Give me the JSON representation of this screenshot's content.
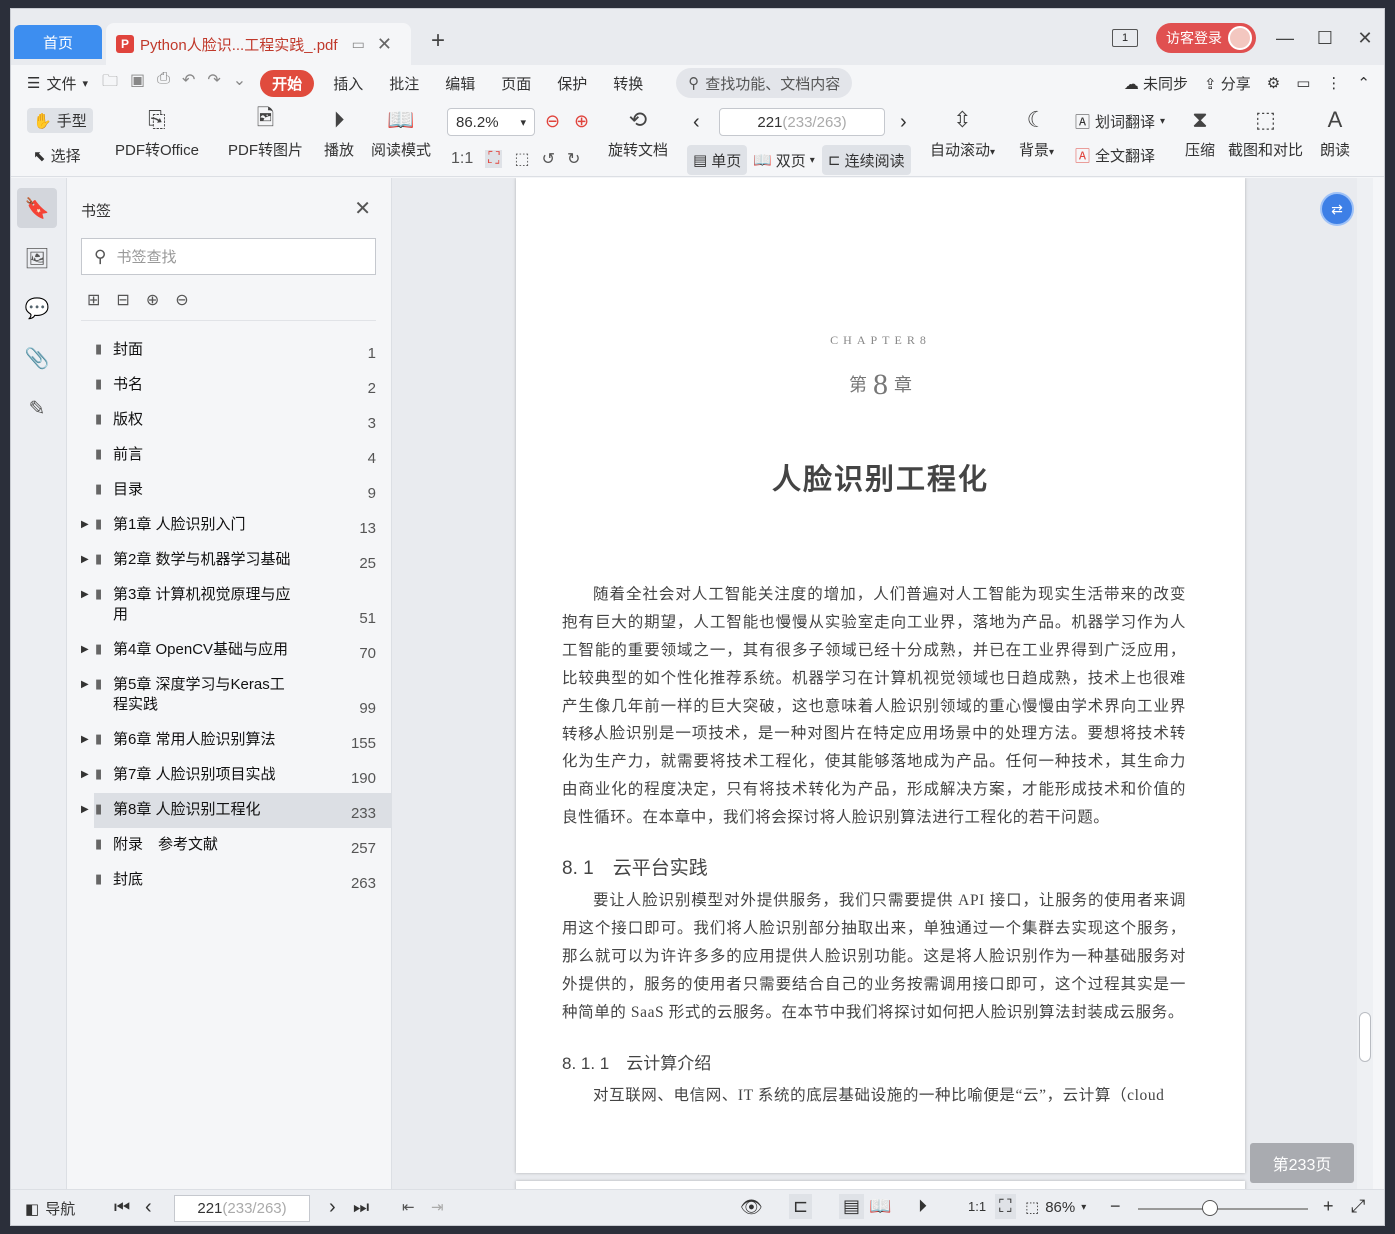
{
  "tabs": {
    "home": "首页",
    "doc": "Python人脸识...工程实践_.pdf"
  },
  "topright": {
    "badge": "1",
    "login": "访客登录"
  },
  "menu": {
    "file": "文件",
    "items": [
      "开始",
      "插入",
      "批注",
      "编辑",
      "页面",
      "保护",
      "转换"
    ],
    "search": "查找功能、文档内容",
    "sync": "未同步",
    "share": "分享"
  },
  "toolbar": {
    "hand": "手型",
    "select": "选择",
    "pdf_office": "PDF转Office",
    "pdf_image": "PDF转图片",
    "play": "播放",
    "read_mode": "阅读模式",
    "zoom": "86.2%",
    "rotate_doc": "旋转文档",
    "page_current": "221",
    "page_total": " (233/263)",
    "single": "单页",
    "double": "双页",
    "continuous": "连续阅读",
    "autoscroll": "自动滚动",
    "background": "背景",
    "word_translate": "划词翻译",
    "full_translate": "全文翻译",
    "compress": "压缩",
    "screenshot_compare": "截图和对比",
    "read_aloud": "朗读"
  },
  "bookmarks": {
    "title": "书签",
    "search_placeholder": "书签查找",
    "items": [
      {
        "text": "封面",
        "page": "1",
        "expandable": false
      },
      {
        "text": "书名",
        "page": "2",
        "expandable": false
      },
      {
        "text": "版权",
        "page": "3",
        "expandable": false
      },
      {
        "text": "前言",
        "page": "4",
        "expandable": false
      },
      {
        "text": "目录",
        "page": "9",
        "expandable": false
      },
      {
        "text": "第1章 人脸识别入门",
        "page": "13",
        "expandable": true
      },
      {
        "text": "第2章 数学与机器学习基础",
        "page": "25",
        "expandable": true
      },
      {
        "text": "第3章 计算机视觉原理与应用",
        "page": "51",
        "expandable": true
      },
      {
        "text": "第4章 OpenCV基础与应用",
        "page": "70",
        "expandable": true
      },
      {
        "text": "第5章 深度学习与Keras工程实践",
        "page": "99",
        "expandable": true
      },
      {
        "text": "第6章 常用人脸识别算法",
        "page": "155",
        "expandable": true
      },
      {
        "text": "第7章 人脸识别项目实战",
        "page": "190",
        "expandable": true
      },
      {
        "text": "第8章 人脸识别工程化",
        "page": "233",
        "expandable": true,
        "selected": true
      },
      {
        "text": "附录　参考文献",
        "page": "257",
        "expandable": false
      },
      {
        "text": "封底",
        "page": "263",
        "expandable": false
      }
    ]
  },
  "page": {
    "chapter_en": "CHAPTER8",
    "chapter_prefix": "第",
    "chapter_num": "8",
    "chapter_suffix": "章",
    "chapter_title": "人脸识别工程化",
    "p1": "随着全社会对人工智能关注度的增加，人们普遍对人工智能为现实生活带来的改变抱有巨大的期望，人工智能也慢慢从实验室走向工业界，落地为产品。机器学习作为人工智能的重要领域之一，其有很多子领域已经十分成熟，并已在工业界得到广泛应用，比较典型的如个性化推荐系统。机器学习在计算机视觉领域也日趋成熟，技术上也很难产生像几年前一样的巨大突破，这也意味着人脸识别领域的重心慢慢由学术界向工业界转移。",
    "p2": "人脸识别是一项技术，是一种对图片在特定应用场景中的处理方法。要想将技术转化为生产力，就需要将技术工程化，使其能够落地成为产品。任何一种技术，其生命力由商业化的程度决定，只有将技术转化为产品，形成解决方案，才能形成技术和价值的良性循环。在本章中，我们将会探讨将人脸识别算法进行工程化的若干问题。",
    "h_81": "8. 1　云平台实践",
    "p3": "要让人脸识别模型对外提供服务，我们只需要提供 API 接口，让服务的使用者来调用这个接口即可。我们将人脸识别部分抽取出来，单独通过一个集群去实现这个服务，那么就可以为许许多多的应用提供人脸识别功能。这是将人脸识别作为一种基础服务对外提供的，服务的使用者只需要结合自己的业务按需调用接口即可，这个过程其实是一种简单的 SaaS 形式的云服务。在本节中我们将探讨如何把人脸识别算法封装成云服务。",
    "h_811": "8. 1. 1　云计算介绍",
    "p4": "对互联网、电信网、IT 系统的底层基础设施的一种比喻便是“云”，云计算（cloud",
    "page_label": "第233页"
  },
  "status": {
    "nav": "导航",
    "page_current": "221",
    "page_total": " (233/263)",
    "zoom": "86%"
  }
}
